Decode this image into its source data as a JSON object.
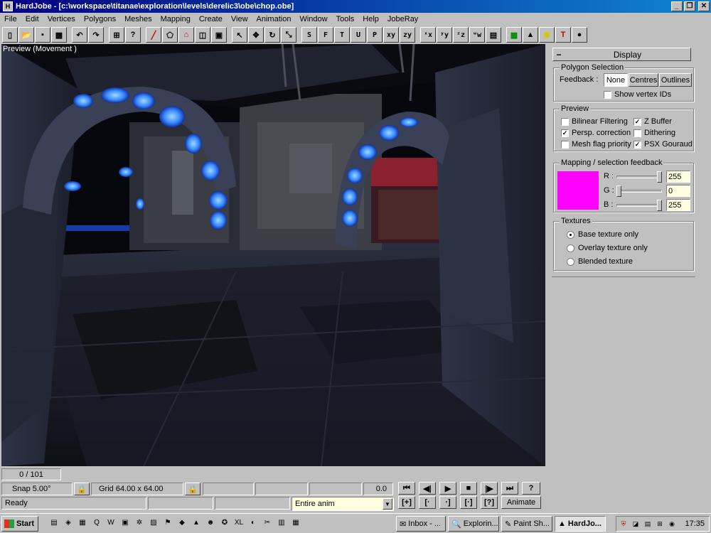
{
  "window": {
    "title": "HardJobe - [c:\\workspace\\titanae\\exploration\\levels\\derelic3\\obe\\chop.obe]",
    "controls": [
      "_",
      "❐",
      "✕"
    ]
  },
  "menu": [
    "File",
    "Edit",
    "Vertices",
    "Polygons",
    "Meshes",
    "Mapping",
    "Create",
    "View",
    "Animation",
    "Window",
    "Tools",
    "Help",
    "JobeRay"
  ],
  "toolbar": {
    "icons": [
      "new-icon",
      "open-icon",
      "save-icon",
      "save-all-icon",
      "undo-icon",
      "redo-icon",
      "tree-icon",
      "help-icon",
      "line-icon",
      "polygon-icon",
      "house-icon",
      "cube-icon",
      "box-icon",
      "select-arrow-icon",
      "move-icon",
      "rotate-icon",
      "scale-icon"
    ],
    "letter_buttons": [
      "S",
      "F",
      "T",
      "U",
      "P",
      "xy",
      "zy"
    ],
    "axis_buttons": [
      "ˣx",
      "ʸy",
      "ᶻz",
      "ʷw"
    ],
    "right_icons": [
      "page-icon",
      "map-icon",
      "cone-icon",
      "bulb-icon",
      "hammer-icon",
      "sphere-icon"
    ]
  },
  "viewport": {
    "label": "Preview (Movement )"
  },
  "panel": {
    "title": "Display",
    "collapse": "−",
    "polygon_selection": {
      "title": "Polygon Selection",
      "feedback_label": "Feedback :",
      "buttons": [
        "None",
        "Centres",
        "Outlines"
      ],
      "show_vertex_ids": {
        "label": "Show vertex IDs",
        "checked": false
      }
    },
    "preview": {
      "title": "Preview",
      "options": [
        {
          "label": "Bilinear Filtering",
          "checked": false
        },
        {
          "label": "Z Buffer",
          "checked": true
        },
        {
          "label": "Persp. correction",
          "checked": true
        },
        {
          "label": "Dithering",
          "checked": false
        },
        {
          "label": "Mesh flag priority",
          "checked": false
        },
        {
          "label": "PSX Gouraud",
          "checked": true
        }
      ]
    },
    "mapping": {
      "title": "Mapping / selection feedback",
      "color": "#ff00ff",
      "r": {
        "label": "R :",
        "value": "255",
        "level": 1.0
      },
      "g": {
        "label": "G :",
        "value": "0",
        "level": 0.0
      },
      "b": {
        "label": "B :",
        "value": "255",
        "level": 1.0
      }
    },
    "textures": {
      "title": "Textures",
      "options": [
        {
          "label": "Base texture only",
          "selected": true
        },
        {
          "label": "Overlay texture only",
          "selected": false
        },
        {
          "label": "Blended texture",
          "selected": false
        }
      ]
    }
  },
  "status": {
    "frame": "0 / 101",
    "snap": "Snap 5.00°",
    "grid": "Grid 64.00 x 64.00",
    "value": "0.0",
    "ready": "Ready",
    "anim_select": "Entire anim",
    "animate": "Animate",
    "lock": "🔒",
    "anim_buttons_row1": [
      "⏮",
      "◀|",
      "▶",
      "■",
      "|▶",
      "⏭",
      "?"
    ],
    "anim_buttons_row2": [
      "[+]",
      "[·",
      "·]",
      "[·]",
      "[?]"
    ]
  },
  "taskbar": {
    "start": "Start",
    "quicklaunch": [
      "▤",
      "◈",
      "▦",
      "Q",
      "W",
      "▣",
      "✲",
      "▨",
      "⚑",
      "◆",
      "▲",
      "☻",
      "✪",
      "XL",
      "◐",
      "✂",
      "▥",
      "▦"
    ],
    "tasks": [
      {
        "label": "Inbox - ...",
        "active": false
      },
      {
        "label": "Explorin...",
        "active": false
      },
      {
        "label": "Paint Sh...",
        "active": false
      },
      {
        "label": "HardJo...",
        "active": true
      }
    ],
    "tray": [
      "⛨",
      "◪",
      "▤",
      "⊞",
      "◉"
    ],
    "clock": "17:35"
  }
}
